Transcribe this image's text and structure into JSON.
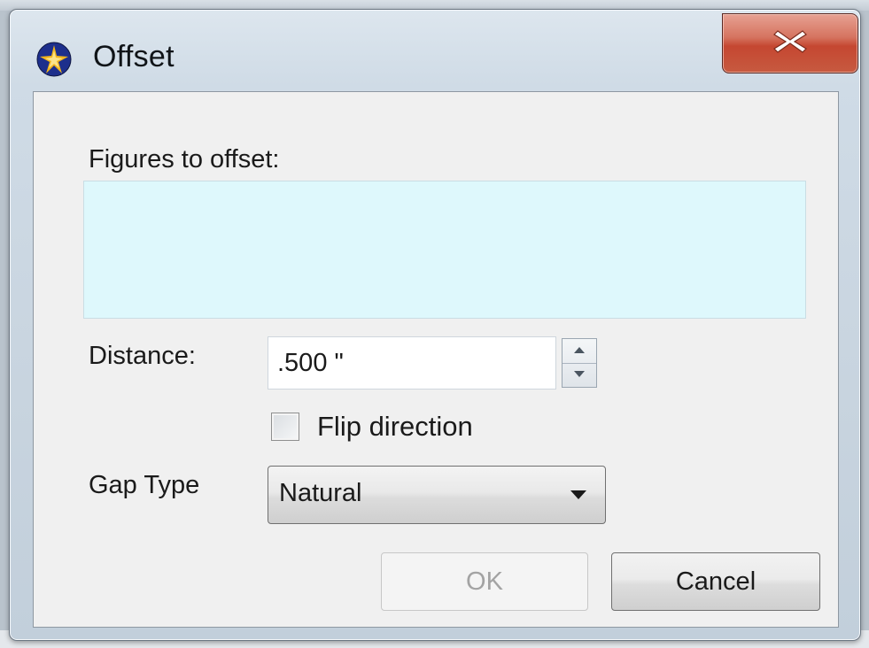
{
  "window": {
    "title": "Offset",
    "app_icon": "app-logo-icon",
    "close_icon": "close-icon",
    "accent_close": "#c75a40"
  },
  "figures": {
    "label": "Figures to offset:",
    "box_color": "#def8fc"
  },
  "distance": {
    "label": "Distance:",
    "value": ".500 \"",
    "spinner_up_icon": "spin-up-icon",
    "spinner_down_icon": "spin-down-icon"
  },
  "flip": {
    "label": "Flip direction",
    "checked": false
  },
  "gap": {
    "label": "Gap Type",
    "selected": "Natural",
    "dropdown_icon": "chevron-down-icon"
  },
  "buttons": {
    "ok_label": "OK",
    "ok_enabled": false,
    "cancel_label": "Cancel"
  }
}
